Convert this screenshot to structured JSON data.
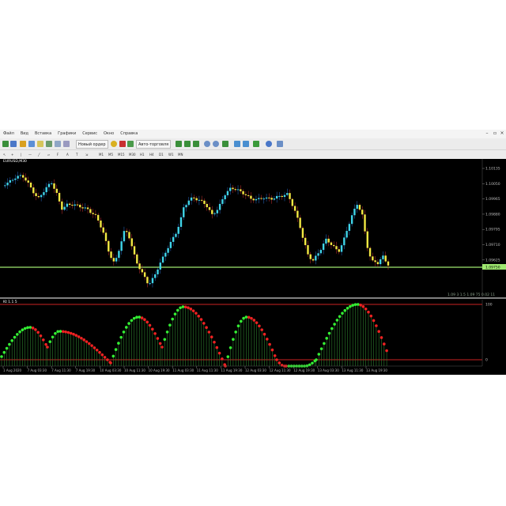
{
  "menu": {
    "items": [
      "Файл",
      "Вид",
      "Вставка",
      "Графики",
      "Сервис",
      "Окно",
      "Справка"
    ]
  },
  "toolbar": {
    "new_order_label": "Новый ордер",
    "autotrading_label": "Авто-торговля",
    "timeframes": [
      "M1",
      "M5",
      "M15",
      "M30",
      "H1",
      "H4",
      "D1",
      "W1",
      "MN"
    ]
  },
  "chart": {
    "symbol_title": "EURUSD,M30",
    "current_price_label": "1.09750",
    "price_labels": [
      "1.10135",
      "1.10050",
      "1.09965",
      "1.09880",
      "1.09795",
      "1.09710",
      "1.09625"
    ],
    "ohlc_info": "1.09 3 1.5 1.09 75 0.02 11",
    "indicator_title": "Kt 1.1 5",
    "indicator_top_label": "100",
    "indicator_bottom_label": "0",
    "time_labels": [
      "1 Aug 2020",
      "7 Aug 03:30",
      "7 Aug 11:30",
      "7 Aug 19:30",
      "10 Aug 03:30",
      "10 Aug 11:30",
      "10 Aug 19:30",
      "11 Aug 03:30",
      "11 Aug 11:30",
      "11 Aug 19:30",
      "12 Aug 03:30",
      "12 Aug 11:30",
      "12 Aug 19:30",
      "13 Aug 03:30",
      "13 Aug 11:30",
      "13 Aug 19:30"
    ]
  },
  "colors": {
    "bull": "#3fd4e8",
    "bear": "#f2e842",
    "level_line": "#9fe870",
    "dot_up": "#33ee33",
    "dot_down": "#ee2222",
    "histogram": "#2e7d2e",
    "indicator_border": "#cc2222"
  }
}
